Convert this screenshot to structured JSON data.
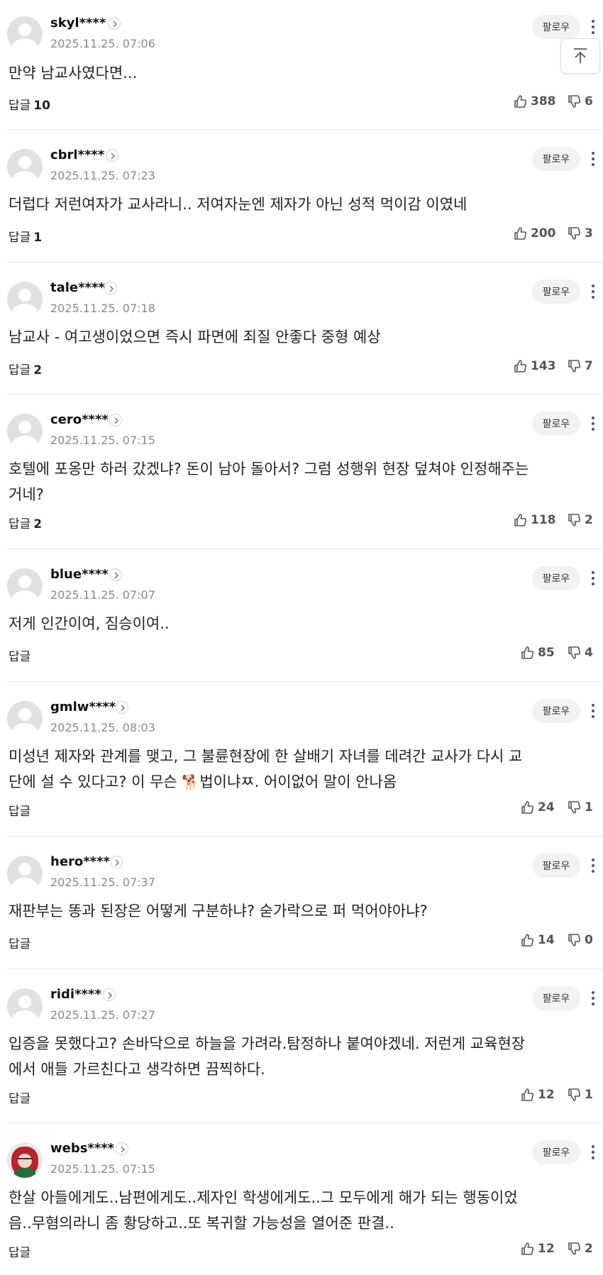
{
  "follow_label": "팔로우",
  "reply_label": "답글",
  "comments": [
    {
      "username": "skyl****",
      "timestamp": "2025.11.25. 07:06",
      "lines": [
        "만약 남교사였다면..."
      ],
      "replies": "10",
      "likes": "388",
      "dislikes": "6"
    },
    {
      "username": "cbrl****",
      "timestamp": "2025.11.25. 07:23",
      "lines": [
        "더럽다 저런여자가 교사라니.. 저여자눈엔 제자가 아닌 성적 먹이감 이였네"
      ],
      "replies": "1",
      "likes": "200",
      "dislikes": "3"
    },
    {
      "username": "tale****",
      "timestamp": "2025.11.25. 07:18",
      "lines": [
        "남교사 - 여고생이었으면 즉시 파면에 죄질 안좋다 중형 예상"
      ],
      "replies": "2",
      "likes": "143",
      "dislikes": "7"
    },
    {
      "username": "cero****",
      "timestamp": "2025.11.25. 07:15",
      "lines": [
        "호텔에 포옹만 하러 갔겠냐? 돈이 남아 돌아서? 그럼 성행위 현장 덮쳐야 인정해주는",
        "거네?"
      ],
      "replies": "2",
      "likes": "118",
      "dislikes": "2"
    },
    {
      "username": "blue****",
      "timestamp": "2025.11.25. 07:07",
      "lines": [
        "저게 인간이여, 짐승이여.."
      ],
      "replies": "",
      "likes": "85",
      "dislikes": "4"
    },
    {
      "username": "gmlw****",
      "timestamp": "2025.11.25. 08:03",
      "lines": [
        "미성년 제자와 관계를 맺고, 그 불륜현장에 한 살배기 자녀를 데려간 교사가 다시 교",
        "단에 설 수 있다고? 이 무슨 ",
        "법이냐ㅉ. 어이없어 말이 안나옴"
      ],
      "emoji": "🐕",
      "replies": "",
      "likes": "24",
      "dislikes": "1"
    },
    {
      "username": "hero****",
      "timestamp": "2025.11.25. 07:37",
      "lines": [
        "재판부는 똥과 된장은 어떻게 구분하냐? 숟가락으로 퍼 먹어야아냐?"
      ],
      "replies": "",
      "likes": "14",
      "dislikes": "0"
    },
    {
      "username": "ridi****",
      "timestamp": "2025.11.25. 07:27",
      "lines": [
        "입증을 못했다고? 손바닥으로 하늘을 가려라.탐정하나 붙여야겠네. 저런게 교육현장",
        "에서 애들 가르친다고 생각하면 끔찍하다."
      ],
      "replies": "",
      "likes": "12",
      "dislikes": "1"
    },
    {
      "username": "webs****",
      "timestamp": "2025.11.25. 07:15",
      "lines": [
        "한살 아들에게도..남편에게도..제자인 학생에게도..그 모두에게 해가 되는 행동이었",
        "음..무혐의라니 좀 황당하고..또 복귀할 가능성을 열어준 판결.."
      ],
      "replies": "",
      "likes": "12",
      "dislikes": "2"
    }
  ]
}
